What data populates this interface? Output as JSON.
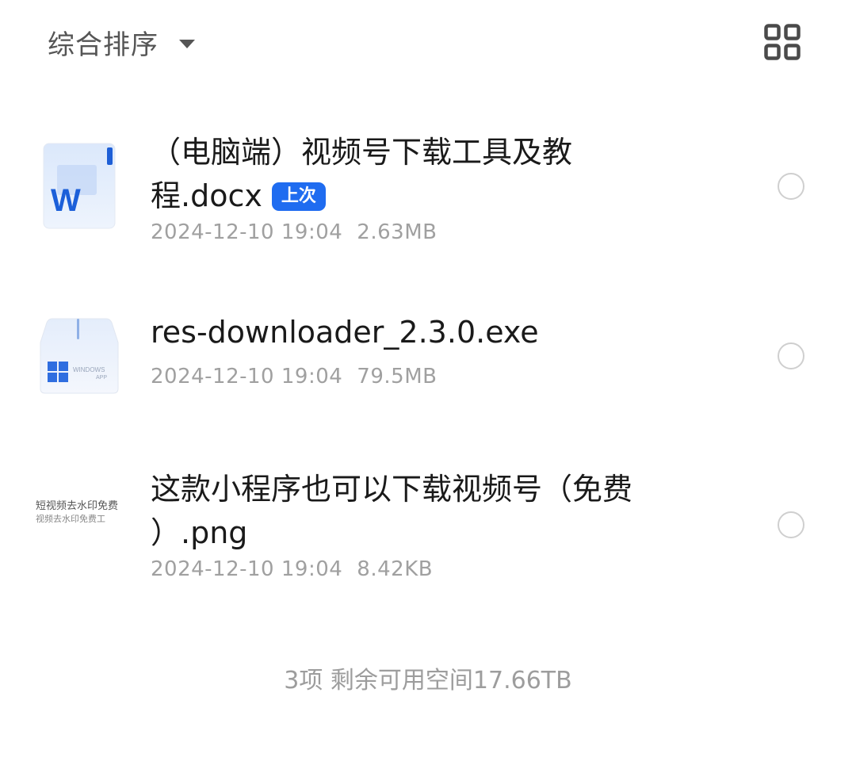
{
  "toolbar": {
    "sort_label": "综合排序",
    "sort_icon": "caret-down-icon",
    "view_toggle_icon": "grid-view-icon"
  },
  "files": [
    {
      "name_line1": "（电脑端）视频号下载工具及教",
      "name_line2": "程.docx",
      "badge": "上次",
      "date": "2024-12-10 19:04",
      "size": "2.63MB",
      "icon": "word-document-icon"
    },
    {
      "name_line1": "res-downloader_2.3.0.exe",
      "date": "2024-12-10 19:04",
      "size": "79.5MB",
      "icon": "windows-app-icon",
      "icon_text_1": "WINDOWS",
      "icon_text_2": "APP"
    },
    {
      "name_line1": "这款小程序也可以下载视频号（免费",
      "name_line2": "）.png",
      "date": "2024-12-10 19:04",
      "size": "8.42KB",
      "icon": "image-thumbnail",
      "thumb_line1": "短视频去水印免费",
      "thumb_line2": "视频去水印免费工"
    }
  ],
  "footer": {
    "summary": "3项 剩余可用空间17.66TB"
  },
  "colors": {
    "badge": "#1f6cf0",
    "primary_text": "#1a1a1a",
    "secondary_text": "#a0a0a0"
  }
}
